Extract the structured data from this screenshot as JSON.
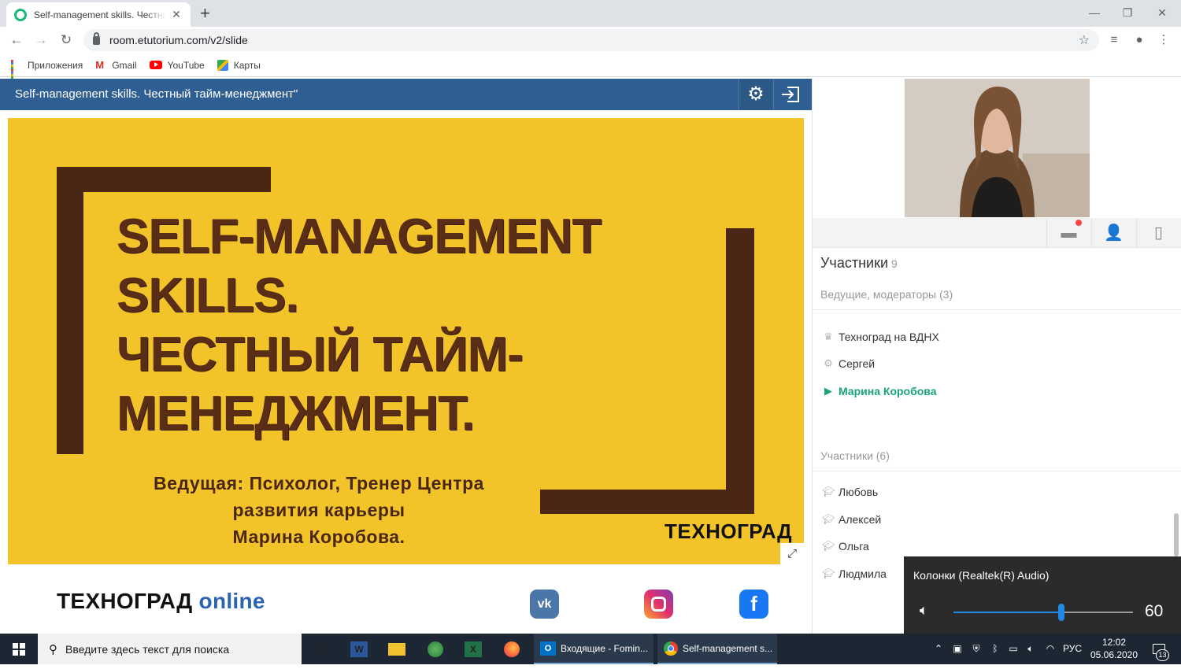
{
  "browser": {
    "tab_title": "Self-management skills. Честный тайм-менеджмент",
    "url": "room.etutorium.com/v2/slide",
    "bookmarks": [
      {
        "label": "Приложения",
        "icon": "apps-grid-icon"
      },
      {
        "label": "Gmail",
        "icon": "gmail-icon"
      },
      {
        "label": "YouTube",
        "icon": "youtube-icon"
      },
      {
        "label": "Карты",
        "icon": "maps-icon"
      }
    ]
  },
  "room": {
    "title": "Self-management skills. Честный тайм-менеджмент\"",
    "slide": {
      "heading_lines": [
        "SELF-MANAGEMENT",
        "SKILLS.",
        "ЧЕСТНЫЙ ТАЙМ-",
        "МЕНЕДЖМЕНТ."
      ],
      "sub_lines": [
        "Ведущая: Психолог, Тренер Центра",
        "развития карьеры",
        "Марина Коробова."
      ],
      "logo": "ТЕХНОГРАД"
    },
    "footer": {
      "logo_main": "ТЕХНОГРАД",
      "logo_suffix": "online",
      "socials": [
        "vk-icon",
        "instagram-icon",
        "facebook-icon"
      ]
    }
  },
  "participants": {
    "title": "Участники",
    "count": "9",
    "hosts_header": "Ведущие, модераторы (3)",
    "hosts": [
      {
        "name": "Техноград на ВДНХ",
        "icon": "crown-icon",
        "active": false
      },
      {
        "name": "Сергей",
        "icon": "gear-icon",
        "active": false
      },
      {
        "name": "Марина Коробова",
        "icon": "play-icon",
        "active": true
      }
    ],
    "members_header": "Участники (6)",
    "members": [
      {
        "name": "Любовь",
        "icon": "graduation-cap-icon"
      },
      {
        "name": "Алексей",
        "icon": "graduation-cap-icon"
      },
      {
        "name": "Ольга",
        "icon": "graduation-cap-icon"
      },
      {
        "name": "Людмила",
        "icon": "graduation-cap-icon"
      }
    ]
  },
  "volume": {
    "device": "Колонки (Realtek(R) Audio)",
    "value": "60",
    "level": 0.6
  },
  "taskbar": {
    "search_placeholder": "Введите здесь текст для поиска",
    "windows": [
      "Входящие - Fomin...",
      "Self-management s..."
    ],
    "language": "РУС",
    "time": "12:02",
    "date": "05.06.2020",
    "notifications": "13"
  },
  "colors": {
    "slide_bg": "#f2c42a",
    "slide_brown": "#4a2614",
    "header_blue": "#2f5e93",
    "active_green": "#1aa37a"
  }
}
